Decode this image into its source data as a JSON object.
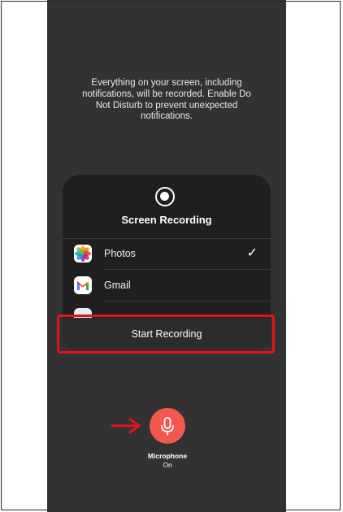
{
  "notice": {
    "line1": "Everything on your screen, including",
    "line2": "notifications, will be recorded. Enable Do",
    "line3": "Not Disturb to prevent unexpected",
    "line4": "notifications."
  },
  "panel": {
    "title": "Screen Recording",
    "icon": "record-icon",
    "apps": [
      {
        "name": "Photos",
        "icon": "photos-icon",
        "selected": true,
        "check_glyph": "✓"
      },
      {
        "name": "Gmail",
        "icon": "gmail-icon",
        "selected": false
      }
    ],
    "start_button_label": "Start Recording"
  },
  "microphone": {
    "label": "Microphone",
    "state": "On",
    "icon": "microphone-icon"
  },
  "annotations": {
    "highlight_color": "#e5121b",
    "arrow_color": "#e5121b"
  },
  "colors": {
    "background": "#323232",
    "panel": "#1f1f1f",
    "mic_button": "#f2584f"
  }
}
